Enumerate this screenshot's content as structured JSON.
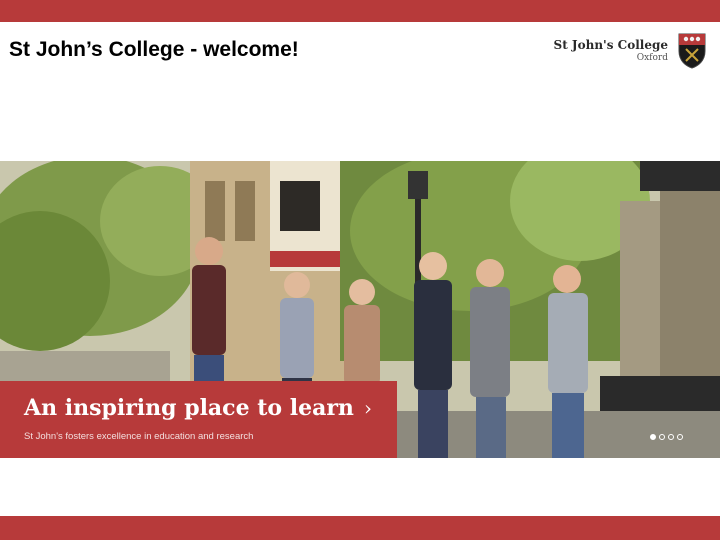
{
  "slide": {
    "title": "St John’s College - welcome!"
  },
  "logo": {
    "name": "St John's College",
    "sub": "Oxford",
    "icon": "crest-icon"
  },
  "banner": {
    "headline": "An inspiring place to learn",
    "chevron": "›",
    "subtext": "St John's fosters excellence in education and research",
    "carousel": {
      "count": 4,
      "active": 1
    }
  },
  "colors": {
    "accent": "#b73a3a"
  }
}
